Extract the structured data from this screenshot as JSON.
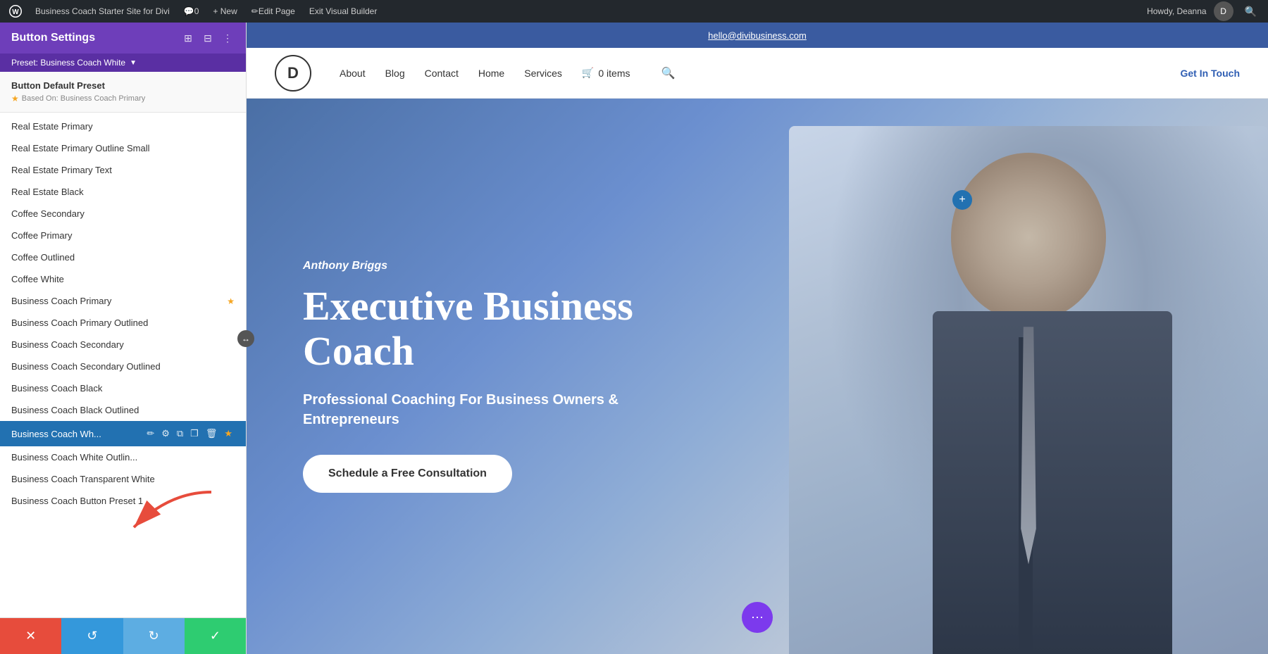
{
  "adminBar": {
    "wpLogo": "⊕",
    "siteName": "Business Coach Starter Site for Divi",
    "commentCount": "0",
    "newLabel": "+ New",
    "editPage": "Edit Page",
    "exitBuilder": "Exit Visual Builder",
    "howdy": "Howdy, Deanna",
    "searchIcon": "🔍"
  },
  "leftPanel": {
    "title": "Button Settings",
    "preset": "Preset: Business Coach White",
    "defaultPreset": {
      "title": "Button Default Preset",
      "basedOn": "Based On: Business Coach Primary"
    },
    "presets": [
      {
        "id": "real-estate-primary",
        "label": "Real Estate Primary",
        "active": false,
        "starred": false
      },
      {
        "id": "real-estate-primary-outline-small",
        "label": "Real Estate Primary Outline Small",
        "active": false,
        "starred": false
      },
      {
        "id": "real-estate-primary-text",
        "label": "Real Estate Primary Text",
        "active": false,
        "starred": false
      },
      {
        "id": "real-estate-black",
        "label": "Real Estate Black",
        "active": false,
        "starred": false
      },
      {
        "id": "coffee-secondary",
        "label": "Coffee Secondary",
        "active": false,
        "starred": false
      },
      {
        "id": "coffee-primary",
        "label": "Coffee Primary",
        "active": false,
        "starred": false
      },
      {
        "id": "coffee-outlined",
        "label": "Coffee Outlined",
        "active": false,
        "starred": false
      },
      {
        "id": "coffee-white",
        "label": "Coffee White",
        "active": false,
        "starred": false
      },
      {
        "id": "business-coach-primary",
        "label": "Business Coach Primary",
        "active": false,
        "starred": true
      },
      {
        "id": "business-coach-primary-outlined",
        "label": "Business Coach Primary Outlined",
        "active": false,
        "starred": false
      },
      {
        "id": "business-coach-secondary",
        "label": "Business Coach Secondary",
        "active": false,
        "starred": false
      },
      {
        "id": "business-coach-secondary-outlined",
        "label": "Business Coach Secondary Outlined",
        "active": false,
        "starred": false
      },
      {
        "id": "business-coach-black",
        "label": "Business Coach Black",
        "active": false,
        "starred": false
      },
      {
        "id": "business-coach-black-outlined",
        "label": "Business Coach Black Outlined",
        "active": false,
        "starred": false
      },
      {
        "id": "business-coach-white",
        "label": "Business Coach Wh...",
        "active": true,
        "starred": true
      },
      {
        "id": "business-coach-white-outlined",
        "label": "Business Coach White Outlin...",
        "active": false,
        "starred": false
      },
      {
        "id": "business-coach-transparent-white",
        "label": "Business Coach Transparent White",
        "active": false,
        "starred": false
      },
      {
        "id": "business-coach-button-preset-1",
        "label": "Business Coach Button Preset 1",
        "active": false,
        "starred": false
      }
    ],
    "activeToolbar": {
      "editIcon": "✏",
      "settingsIcon": "⚙",
      "duplicateIcon": "⧉",
      "copyIcon": "📋",
      "deleteIcon": "🗑",
      "starIcon": "★"
    },
    "bottomBar": {
      "cancel": "✕",
      "undo": "↺",
      "redo": "↻",
      "confirm": "✓"
    }
  },
  "site": {
    "topbarEmail": "hello@divibusiness.com",
    "logo": "D",
    "navLinks": [
      "About",
      "Blog",
      "Contact",
      "Home",
      "Services"
    ],
    "cartLabel": "0 items",
    "ctaButton": "Get In Touch",
    "hero": {
      "name": "Anthony Briggs",
      "title": "Executive Business Coach",
      "subtitle": "Professional Coaching For Business Owners & Entrepreneurs",
      "ctaButton": "Schedule a Free Consultation"
    }
  }
}
